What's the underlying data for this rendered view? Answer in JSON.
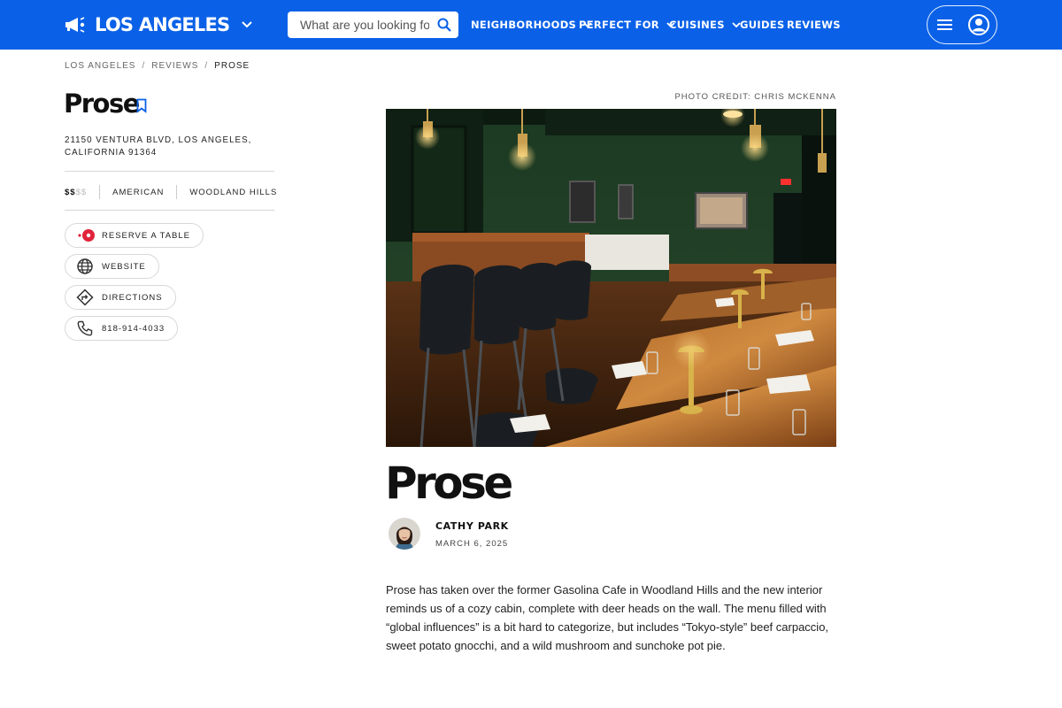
{
  "header": {
    "city": "LOS ANGELES",
    "search_placeholder": "What are you looking for?",
    "nav": [
      {
        "label": "NEIGHBORHOODS",
        "has_dropdown": true
      },
      {
        "label": "PERFECT FOR",
        "has_dropdown": true
      },
      {
        "label": "CUISINES",
        "has_dropdown": true
      },
      {
        "label": "GUIDES",
        "has_dropdown": false
      },
      {
        "label": "REVIEWS",
        "has_dropdown": false
      }
    ],
    "brand_color": "#0a61e8"
  },
  "breadcrumb": {
    "items": [
      "LOS ANGELES",
      "REVIEWS"
    ],
    "separator": "/",
    "current": "PROSE"
  },
  "sidebar": {
    "title": "Prose",
    "address": "21150 VENTURA BLVD, LOS ANGELES, CALIFORNIA 91364",
    "price_active": "$$",
    "price_inactive": "$$",
    "cuisine": "AMERICAN",
    "neighborhood": "WOODLAND HILLS",
    "actions": [
      {
        "label": "RESERVE A TABLE",
        "icon": "resy-icon"
      },
      {
        "label": "WEBSITE",
        "icon": "globe-icon"
      },
      {
        "label": "DIRECTIONS",
        "icon": "directions-icon"
      },
      {
        "label": "818-914-4033",
        "icon": "phone-icon"
      }
    ]
  },
  "article": {
    "photo_credit": "PHOTO CREDIT: CHRIS MCKENNA",
    "title": "Prose",
    "author": "CATHY PARK",
    "date": "MARCH 6, 2025",
    "body": "Prose has taken over the former Gasolina Cafe in Woodland Hills and the new interior reminds us of a cozy cabin, complete with deer heads on the wall. The menu filled with “global influences” is a bit hard to categorize, but includes  “Tokyo-style” beef carpaccio, sweet potato gnocchi, and a wild mushroom and sunchoke pot pie."
  }
}
